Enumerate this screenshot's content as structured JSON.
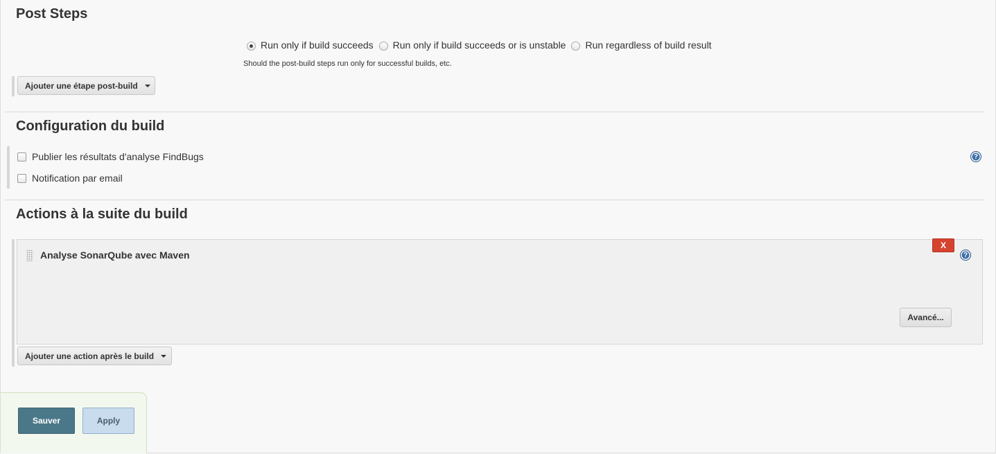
{
  "post_steps": {
    "title": "Post Steps",
    "radio_options": [
      {
        "label": "Run only if build succeeds",
        "checked": true
      },
      {
        "label": "Run only if build succeeds or is unstable",
        "checked": false
      },
      {
        "label": "Run regardless of build result",
        "checked": false
      }
    ],
    "hint": "Should the post-build steps run only for successful builds, etc.",
    "add_step_label": "Ajouter une étape post-build"
  },
  "build_config": {
    "title": "Configuration du build",
    "checkboxes": [
      {
        "label": "Publier les résultats d'analyse FindBugs",
        "checked": false
      },
      {
        "label": "Notification par email",
        "checked": false
      }
    ]
  },
  "post_build_actions": {
    "title": "Actions à la suite du build",
    "panel_title": "Analyse SonarQube avec Maven",
    "delete_label": "X",
    "advanced_label": "Avancé...",
    "add_action_label": "Ajouter une action après le build"
  },
  "footer": {
    "save_label": "Sauver",
    "apply_label": "Apply"
  },
  "icons": {
    "help": "help-icon",
    "dropdown": "caret-down-icon",
    "drag": "drag-handle-icon"
  },
  "colors": {
    "delete_button": "#d5432f",
    "save_button": "#4b7889",
    "apply_button": "#c8dced",
    "help_icon": "#3c6fa8"
  }
}
